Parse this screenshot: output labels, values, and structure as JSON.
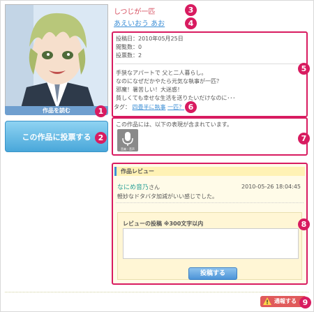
{
  "work": {
    "read_button": "作品を読む",
    "vote_button": "この作品に投票する",
    "title": "しつじが一匹",
    "author": "あえいおう あお"
  },
  "info": {
    "posted": "投稿日：2010年05月25日",
    "views": "閲覧数：0",
    "votes": "投票数：2",
    "desc1": "手狭なアパートで 父と二人暮らし。",
    "desc2": "なのになぜだかやたら元気な執事が一匹？",
    "desc3": "邪魔！暑苦しい！大迷惑！",
    "desc4": "貧しくても幸せな生活を送りたいだけなのに･･･"
  },
  "tags": {
    "label": "タグ：",
    "items": [
      "四畳半に執事",
      "一匹？"
    ]
  },
  "contains": {
    "text": "この作品には、以下の表現が含まれています。",
    "icon_label": "音楽・音声"
  },
  "review": {
    "header": "作品レビュー",
    "reviewer": "なにめ音乃",
    "suffix": "さん",
    "date": "2010-05-26 18:04:45",
    "body": "軽妙なドタバタ加減がいい感じでした。",
    "post_label": "レビューの投稿 ※300文字以内",
    "submit": "投稿する"
  },
  "report": {
    "label": "通報する"
  },
  "markers": [
    "1",
    "2",
    "3",
    "4",
    "5",
    "6",
    "7",
    "8",
    "9"
  ],
  "colors": {
    "accent_pink": "#d81b60",
    "link_blue": "#3d8fd6",
    "button_blue": "#49a7da",
    "title_red": "#d64d5e"
  }
}
